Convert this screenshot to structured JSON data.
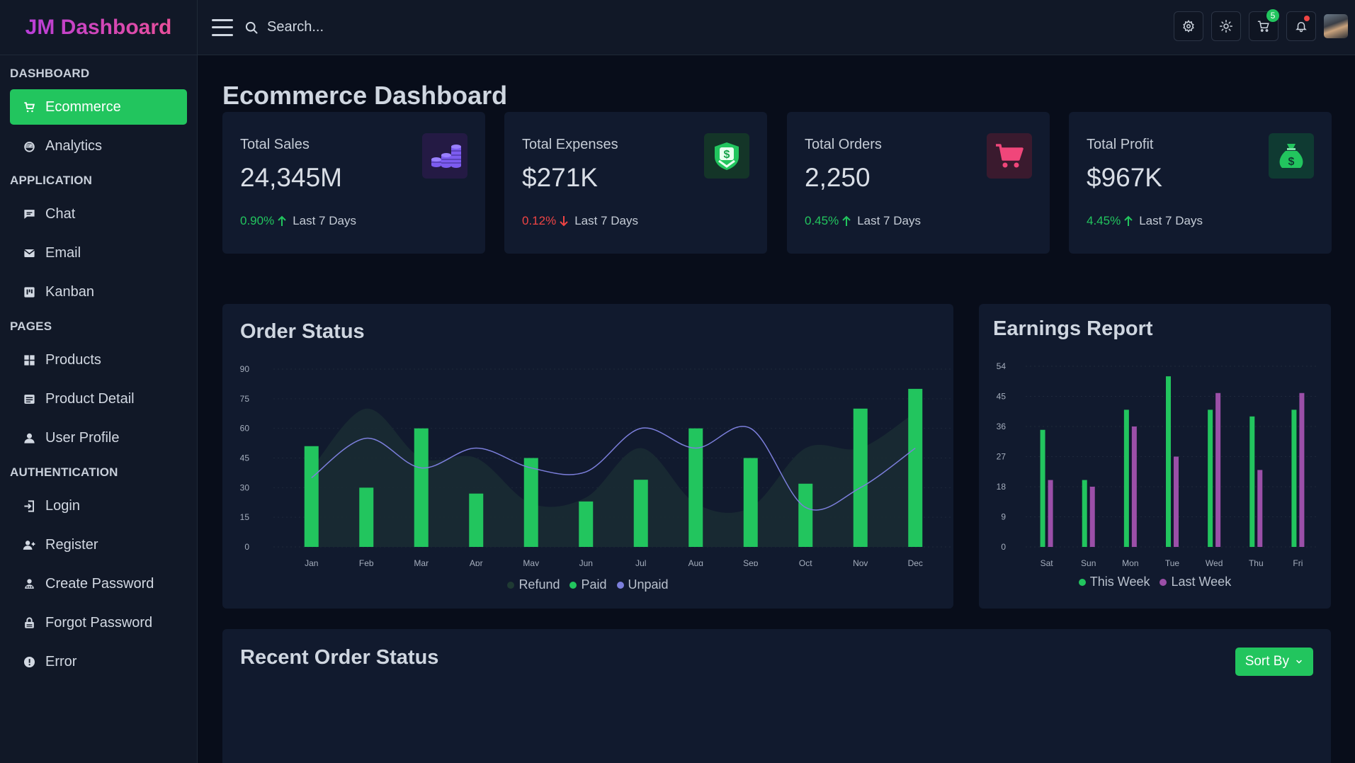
{
  "brand": "JM Dashboard",
  "search": {
    "placeholder": "Search..."
  },
  "topbar": {
    "cart_count": "5"
  },
  "sidebar": {
    "sections": [
      {
        "title": "DASHBOARD",
        "items": [
          {
            "label": "Ecommerce",
            "icon": "cart-icon",
            "active": true
          },
          {
            "label": "Analytics",
            "icon": "gauge-icon"
          }
        ]
      },
      {
        "title": "APPLICATION",
        "items": [
          {
            "label": "Chat",
            "icon": "chat-icon"
          },
          {
            "label": "Email",
            "icon": "mail-icon"
          },
          {
            "label": "Kanban",
            "icon": "kanban-icon"
          }
        ]
      },
      {
        "title": "PAGES",
        "items": [
          {
            "label": "Products",
            "icon": "grid-icon"
          },
          {
            "label": "Product Detail",
            "icon": "detail-icon"
          },
          {
            "label": "User Profile",
            "icon": "user-icon"
          }
        ]
      },
      {
        "title": "AUTHENTICATION",
        "items": [
          {
            "label": "Login",
            "icon": "login-icon"
          },
          {
            "label": "Register",
            "icon": "user-plus-icon"
          },
          {
            "label": "Create Password",
            "icon": "key-icon"
          },
          {
            "label": "Forgot Password",
            "icon": "lock-icon"
          },
          {
            "label": "Error",
            "icon": "alert-icon"
          }
        ]
      }
    ]
  },
  "page": {
    "title": "Ecommerce Dashboard"
  },
  "stats": [
    {
      "label": "Total Sales",
      "value": "24,345M",
      "pct": "0.90%",
      "direction": "up",
      "period": "Last 7 Days",
      "icon": "coins-icon"
    },
    {
      "label": "Total Expenses",
      "value": "$271K",
      "pct": "0.12%",
      "direction": "down",
      "period": "Last 7 Days",
      "icon": "dollar-badge-icon"
    },
    {
      "label": "Total Orders",
      "value": "2,250",
      "pct": "0.45%",
      "direction": "up",
      "period": "Last 7 Days",
      "icon": "shopping-cart-icon"
    },
    {
      "label": "Total Profit",
      "value": "$967K",
      "pct": "4.45%",
      "direction": "up",
      "period": "Last 7 Days",
      "icon": "money-bag-icon"
    }
  ],
  "colors": {
    "accent": "#22c55e",
    "paid": "#22c55e",
    "unpaid": "#7c7fdc",
    "refund": "#1a2b33",
    "last_week": "#9b4fa8"
  },
  "order_status": {
    "title": "Order Status"
  },
  "earnings": {
    "title": "Earnings Report"
  },
  "recent": {
    "title": "Recent Order Status",
    "sort_label": "Sort By"
  },
  "chart_data": [
    {
      "type": "bar",
      "title": "Order Status",
      "categories": [
        "Jan",
        "Feb",
        "Mar",
        "Apr",
        "May",
        "Jun",
        "Jul",
        "Aug",
        "Sep",
        "Oct",
        "Nov",
        "Dec"
      ],
      "y_ticks": [
        0,
        15,
        30,
        45,
        60,
        75,
        90
      ],
      "ylim": [
        0,
        90
      ],
      "series": [
        {
          "name": "Refund",
          "type": "area",
          "values": [
            40,
            70,
            45,
            45,
            22,
            25,
            50,
            22,
            20,
            50,
            50,
            68
          ]
        },
        {
          "name": "Paid",
          "type": "bar",
          "values": [
            51,
            30,
            60,
            27,
            45,
            23,
            34,
            60,
            45,
            32,
            70,
            80
          ]
        },
        {
          "name": "Unpaid",
          "type": "line",
          "values": [
            35,
            55,
            40,
            50,
            40,
            38,
            60,
            50,
            60,
            20,
            30,
            50
          ]
        }
      ],
      "legend": "bottom-center"
    },
    {
      "type": "bar",
      "title": "Earnings Report",
      "categories": [
        "Sat",
        "Sun",
        "Mon",
        "Tue",
        "Wed",
        "Thu",
        "Fri"
      ],
      "y_ticks": [
        0,
        9,
        18,
        27,
        36,
        45,
        54
      ],
      "ylim": [
        0,
        54
      ],
      "series": [
        {
          "name": "This Week",
          "values": [
            35,
            20,
            41,
            51,
            41,
            39,
            41
          ]
        },
        {
          "name": "Last Week",
          "values": [
            20,
            18,
            36,
            27,
            46,
            23,
            46
          ]
        }
      ],
      "legend": "bottom-center"
    }
  ]
}
